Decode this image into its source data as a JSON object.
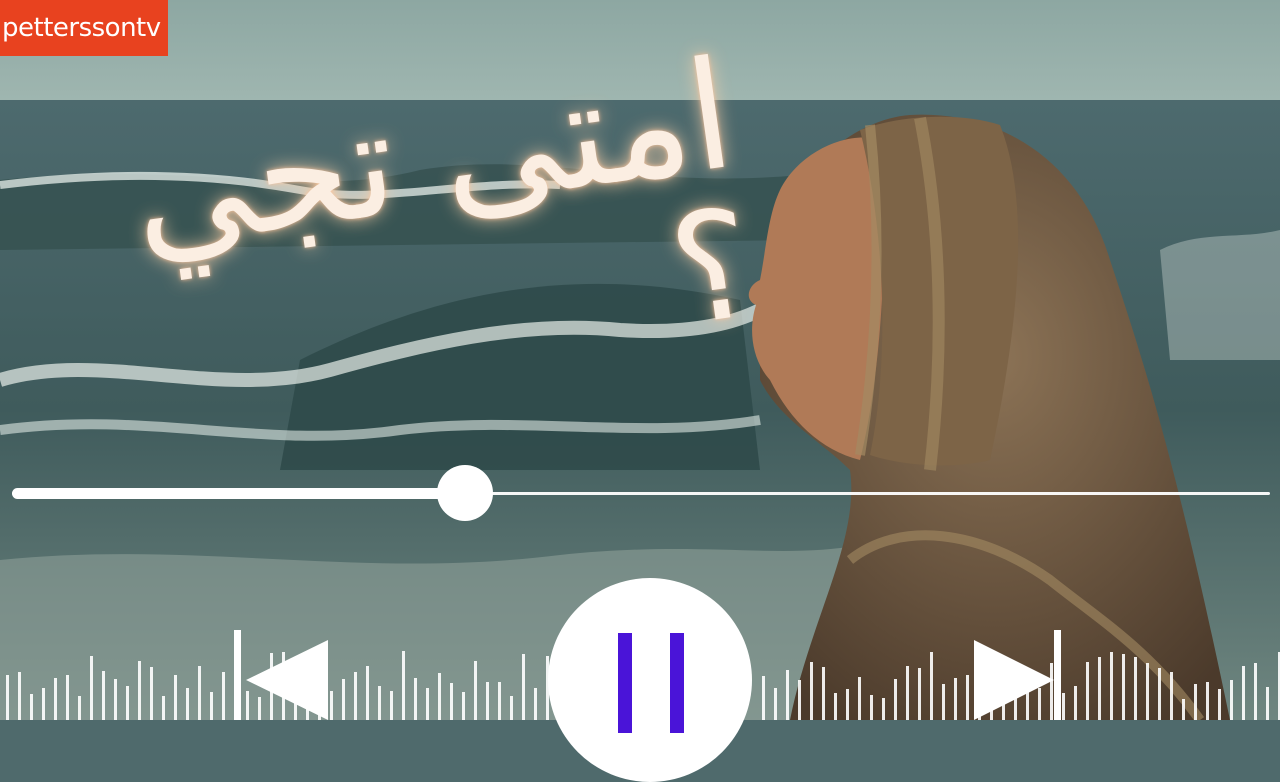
{
  "channel": {
    "name": "petterssontv"
  },
  "title": {
    "text": "امتى تجي ؟"
  },
  "player": {
    "progress": 0.36,
    "state": "playing",
    "controls": [
      "previous",
      "pause",
      "next"
    ]
  },
  "icons": {
    "previous": "skip-previous-icon",
    "pause": "pause-icon",
    "next": "skip-next-icon"
  },
  "colors": {
    "badge": "#e8421f",
    "pause_bars": "#4a14d8",
    "title": "#fbeee2"
  }
}
